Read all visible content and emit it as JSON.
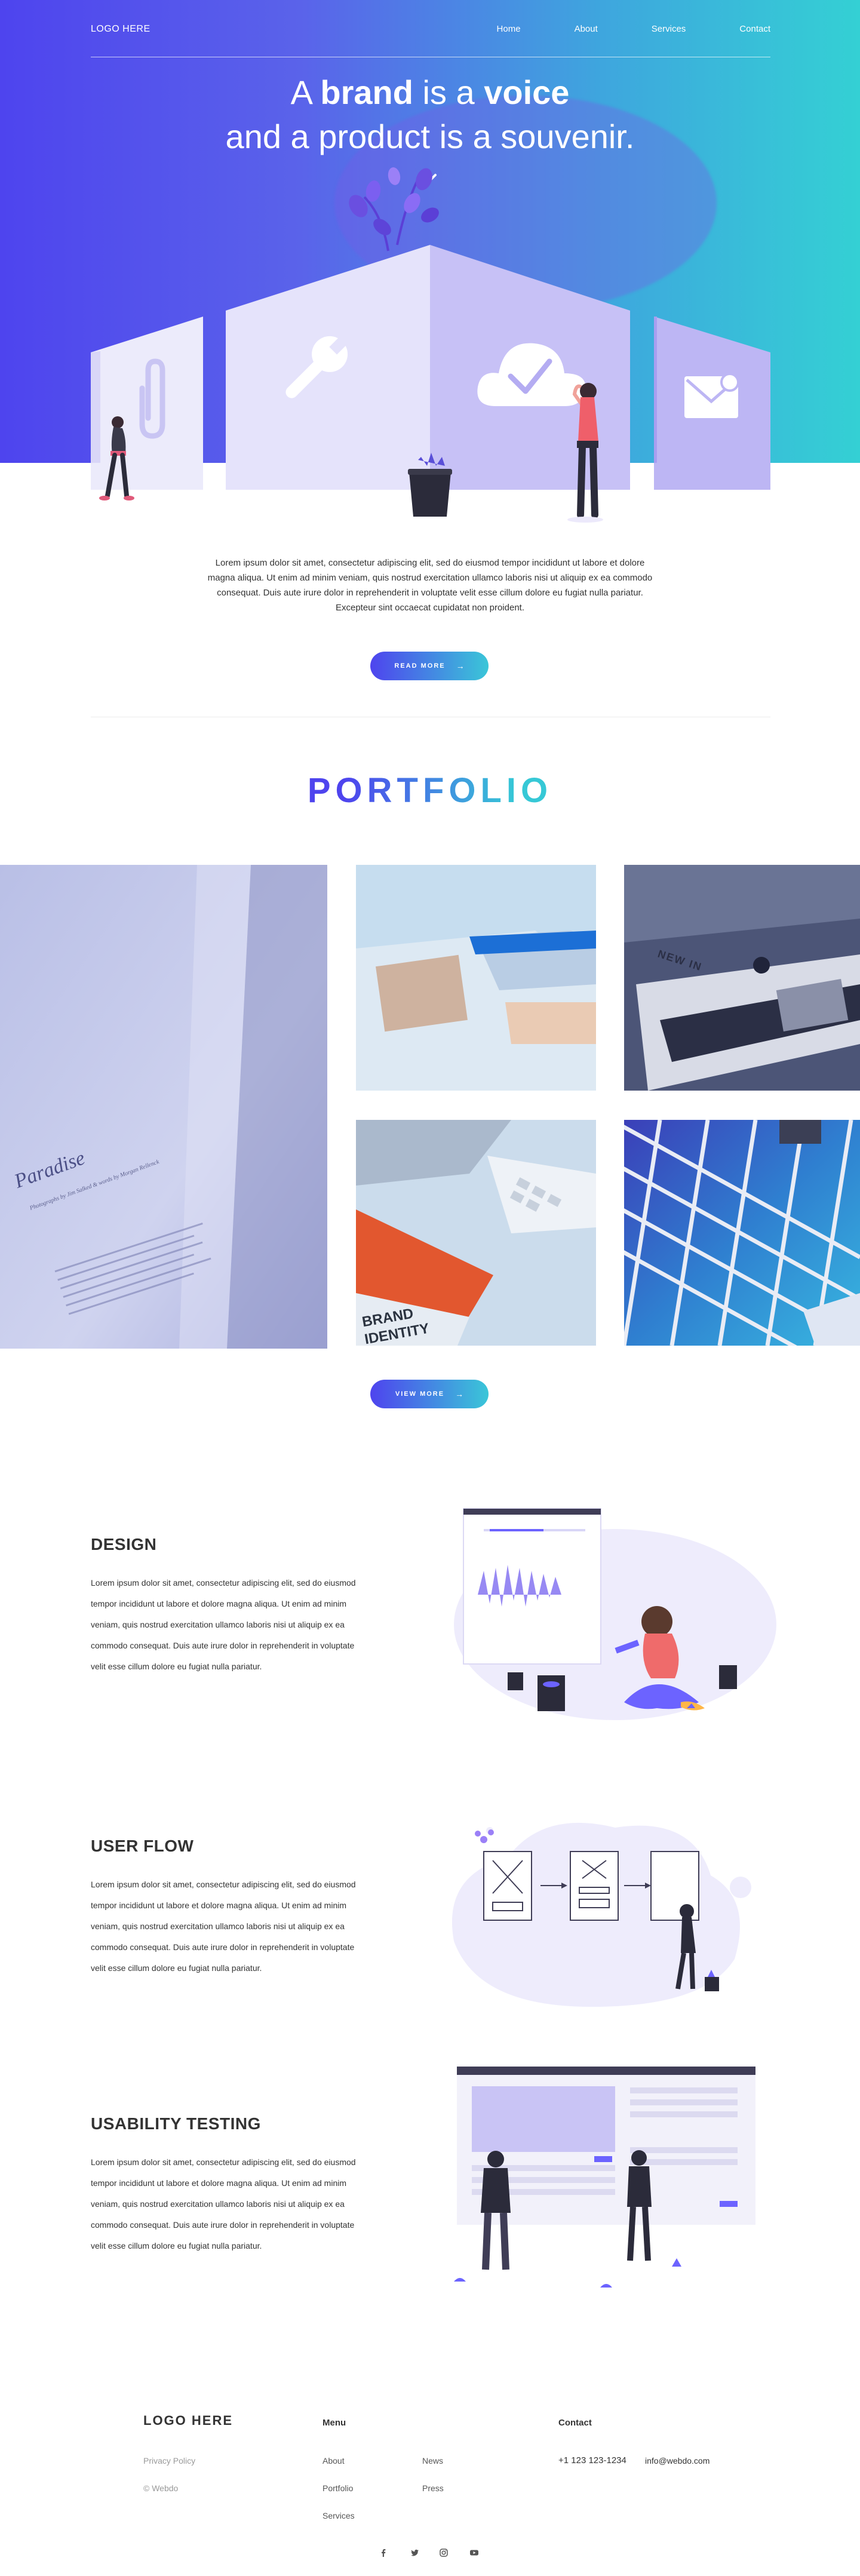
{
  "nav": {
    "logo": "LOGO HERE",
    "links": [
      "Home",
      "About",
      "Services",
      "Contact"
    ]
  },
  "hero": {
    "line1_a": "A ",
    "line1_b": "brand",
    "line1_c": " is a ",
    "line1_d": "voice",
    "line2": "and a product is a souvenir."
  },
  "intro": {
    "text": "Lorem ipsum dolor sit amet, consectetur adipiscing elit, sed do eiusmod tempor incididunt ut labore et dolore magna aliqua. Ut enim ad minim veniam, quis nostrud exercitation ullamco laboris nisi ut aliquip ex ea commodo consequat. Duis aute irure dolor in reprehenderit in voluptate velit esse cillum dolore eu fugiat nulla pariatur. Excepteur sint occaecat cupidatat non proident.",
    "button": "READ MORE"
  },
  "portfolio": {
    "title": "PORTFOLIO",
    "button": "VIEW MORE",
    "book_title": "Paradise",
    "book_subtitle": "Photographs by Jim Salked & words by Morgan Rellenck",
    "magazine_text": "NEW IN",
    "brand_text_1": "BRAND",
    "brand_text_2": "IDENTITY"
  },
  "features": [
    {
      "title": "DESIGN",
      "text": "Lorem ipsum dolor sit amet, consectetur adipiscing elit, sed do eiusmod tempor incididunt ut labore et dolore magna aliqua. Ut enim ad minim veniam, quis nostrud exercitation ullamco laboris nisi ut aliquip ex ea commodo consequat. Duis aute irure dolor in reprehenderit in voluptate velit esse cillum dolore eu fugiat nulla pariatur."
    },
    {
      "title": "USER FLOW",
      "text": "Lorem ipsum dolor sit amet, consectetur adipiscing elit, sed do eiusmod tempor incididunt ut labore et dolore magna aliqua. Ut enim ad minim veniam, quis nostrud exercitation ullamco laboris nisi ut aliquip ex ea commodo consequat. Duis aute irure dolor in reprehenderit in voluptate velit esse cillum dolore eu fugiat nulla pariatur."
    },
    {
      "title": "USABILITY TESTING",
      "text": "Lorem ipsum dolor sit amet, consectetur adipiscing elit, sed do eiusmod tempor incididunt ut labore et dolore magna aliqua. Ut enim ad minim veniam, quis nostrud exercitation ullamco laboris nisi ut aliquip ex ea commodo consequat. Duis aute irure dolor in reprehenderit in voluptate velit esse cillum dolore eu fugiat nulla pariatur."
    }
  ],
  "footer": {
    "logo": "LOGO HERE",
    "privacy": "Privacy Policy",
    "copyright": "© Webdo",
    "menu_head": "Menu",
    "menu_col1": [
      "About",
      "Portfolio",
      "Services"
    ],
    "menu_col2": [
      "News",
      "Press"
    ],
    "contact_head": "Contact",
    "phone": "+1 123 123-1234",
    "email": "info@webdo.com",
    "social_icons": [
      "facebook-icon",
      "twitter-icon",
      "instagram-icon",
      "youtube-icon"
    ]
  },
  "colors": {
    "gradient_start": "#4e44ee",
    "gradient_end": "#34d0d4",
    "accent_purple": "#6c5ce7",
    "illustration_light": "#c9c4f5"
  }
}
